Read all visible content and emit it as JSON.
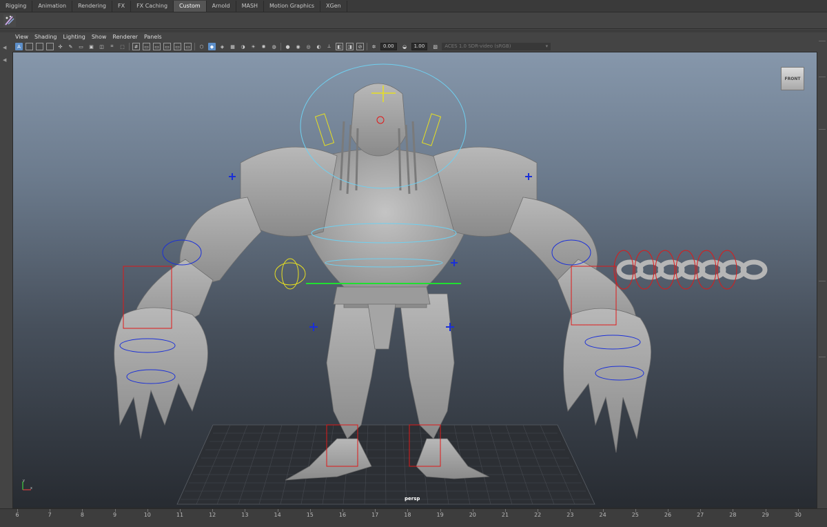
{
  "shelf": {
    "tabs": [
      {
        "label": "Rigging",
        "active": false
      },
      {
        "label": "Animation",
        "active": false
      },
      {
        "label": "Rendering",
        "active": false
      },
      {
        "label": "FX",
        "active": false
      },
      {
        "label": "FX Caching",
        "active": false
      },
      {
        "label": "Custom",
        "active": true
      },
      {
        "label": "Arnold",
        "active": false
      },
      {
        "label": "MASH",
        "active": false
      },
      {
        "label": "Motion Graphics",
        "active": false
      },
      {
        "label": "XGen",
        "active": false
      }
    ],
    "icon": "rig-tool-icon"
  },
  "panel_menu": {
    "items": [
      "View",
      "Shading",
      "Lighting",
      "Show",
      "Renderer",
      "Panels"
    ]
  },
  "panel_toolbar": {
    "exposure_value": "0.00",
    "gamma_value": "1.00",
    "color_space": "ACES 1.0 SDR-video (sRGB)"
  },
  "viewport": {
    "view_cube_label": "FRONT",
    "camera_label": "persp",
    "axis_labels": {
      "x": "x",
      "y": "y"
    }
  },
  "timeslider": {
    "numbers": [
      "6",
      "7",
      "8",
      "9",
      "10",
      "11",
      "12",
      "13",
      "14",
      "15",
      "16",
      "17",
      "18",
      "19",
      "20",
      "21",
      "22",
      "23",
      "24",
      "25",
      "26",
      "27",
      "28",
      "29",
      "30"
    ]
  },
  "colors": {
    "accent_tab": "#555555",
    "control_blue": "#1a2fd8",
    "control_red": "#e01818",
    "control_yellow": "#e8e020",
    "control_cyan": "#6fd0f0",
    "control_green": "#20e030",
    "mesh_grey": "#a9a9a9"
  }
}
